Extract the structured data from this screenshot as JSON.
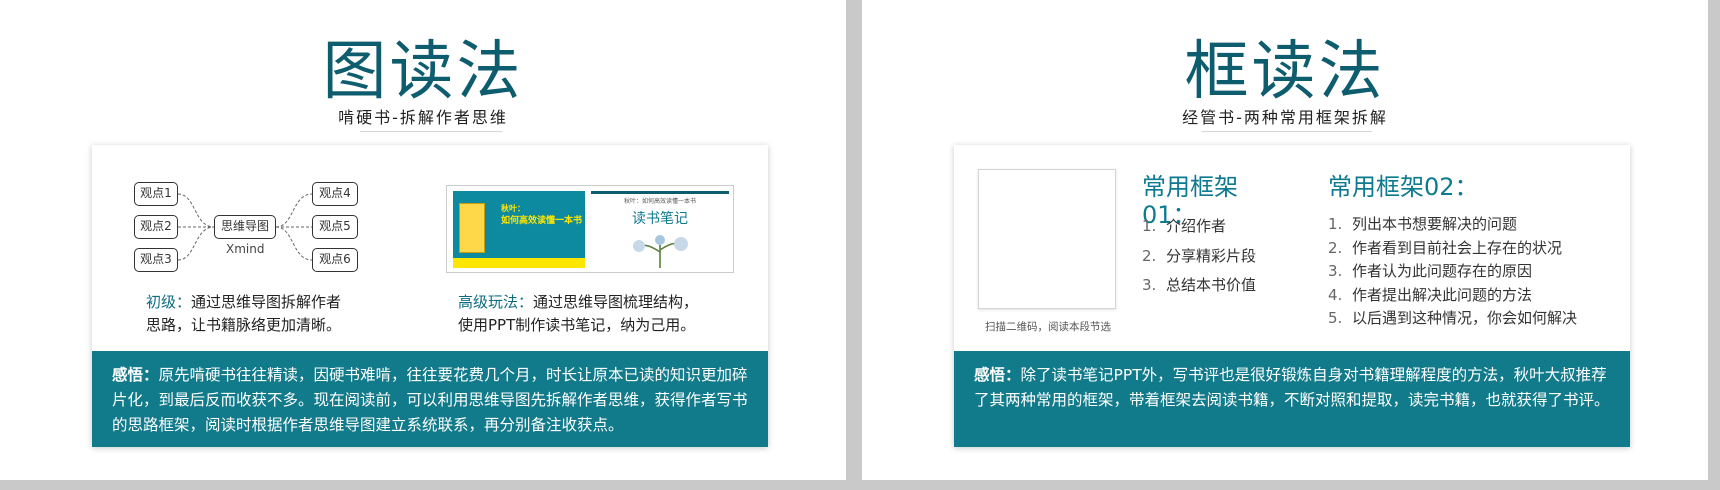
{
  "left": {
    "title": "图读法",
    "subtitle": "啃硬书-拆解作者思维",
    "mindmap": {
      "center": "思维导图",
      "center_sub": "Xmind",
      "left_nodes": [
        "观点1",
        "观点2",
        "观点3"
      ],
      "right_nodes": [
        "观点4",
        "观点5",
        "观点6"
      ]
    },
    "caption_basic": {
      "label": "初级：",
      "line1": "通过思维导图拆解作者",
      "line2": "思路，让书籍脉络更加清晰。"
    },
    "caption_advanced": {
      "label": "高级玩法：",
      "line1": "通过思维导图梳理结构，",
      "line2": "使用PPT制作读书笔记，纳为己用。"
    },
    "book_cover": {
      "t1": "秋叶：",
      "t2": "如何高效读懂一本书"
    },
    "note_cover": {
      "header": "秋叶：如何高效读懂一本书",
      "title": "读书笔记"
    },
    "band": {
      "label": "感悟：",
      "text": "原先啃硬书往往精读，因硬书难啃，往往要花费几个月，时长让原本已读的知识更加碎片化，到最后反而收获不多。现在阅读前，可以利用思维导图先拆解作者思维，获得作者写书的思路框架，阅读时根据作者思维导图建立系统联系，再分别备注收获点。"
    }
  },
  "right": {
    "title": "框读法",
    "subtitle": "经管书-两种常用框架拆解",
    "qr_caption": "扫描二维码，阅读本段节选",
    "framework1": {
      "title": "常用框架01：",
      "items": [
        "介绍作者",
        "分享精彩片段",
        "总结本书价值"
      ]
    },
    "framework2": {
      "title": "常用框架02：",
      "items": [
        "列出本书想要解决的问题",
        "作者看到目前社会上存在的状况",
        "作者认为此问题存在的原因",
        "作者提出解决此问题的方法",
        "以后遇到这种情况，你会如何解决"
      ]
    },
    "band": {
      "label": "感悟：",
      "text": "除了读书笔记PPT外，写书评也是很好锻炼自身对书籍理解程度的方法，秋叶大叔推荐了其两种常用的框架，带着框架去阅读书籍，不断对照和提取，读完书籍，也就获得了书评。"
    }
  },
  "colors": {
    "accent": "#117a8b",
    "title": "#0e5d6e",
    "background": "#c9c9c9"
  }
}
